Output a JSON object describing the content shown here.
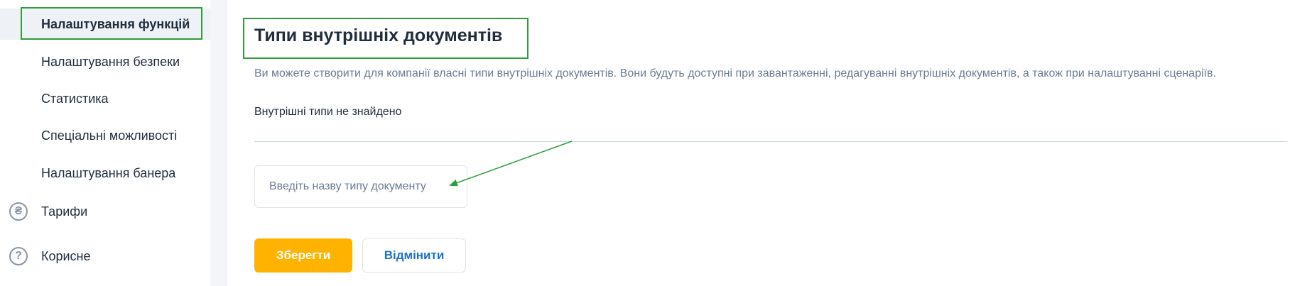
{
  "sidebar": {
    "items": [
      {
        "label": "Налаштування функцій",
        "active": true
      },
      {
        "label": "Налаштування безпеки",
        "active": false
      },
      {
        "label": "Статистика",
        "active": false
      },
      {
        "label": "Спеціальні можливості",
        "active": false
      },
      {
        "label": "Налаштування банера",
        "active": false
      },
      {
        "label": "Тарифи",
        "icon": "hryvnia-circle-icon",
        "icon_glyph": "₴"
      },
      {
        "label": "Корисне",
        "icon": "question-circle-icon",
        "icon_glyph": "?"
      }
    ]
  },
  "main": {
    "title": "Типи внутрішніх документів",
    "description": "Ви можете створити для компанії власні типи внутрішніх документів. Вони будуть доступні при завантаженні, редагуванні внутрішніх документів, а також при налаштуванні сценаріїв.",
    "empty_state": "Внутрішні типи не знайдено",
    "input": {
      "value": "",
      "placeholder": "Введіть назву типу документу"
    },
    "buttons": {
      "save_label": "Зберегти",
      "cancel_label": "Відмінити"
    }
  },
  "colors": {
    "accent": "#ffb300",
    "link": "#1a73c8",
    "annotation": "#2e9e3a"
  }
}
